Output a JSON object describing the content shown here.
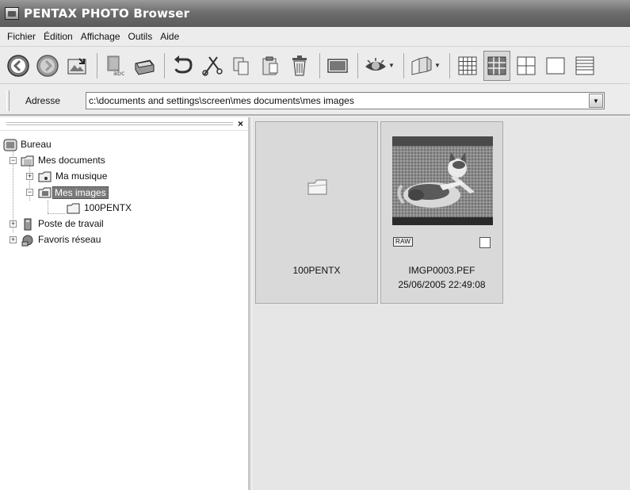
{
  "window": {
    "title": "PENTAX PHOTO Browser"
  },
  "menu": {
    "items": [
      "Fichier",
      "Édition",
      "Affichage",
      "Outils",
      "Aide"
    ]
  },
  "toolbar": {
    "buttons": [
      "back-icon",
      "forward-icon",
      "up-folder-icon",
      "rename-icon",
      "print-icon",
      "rotate-icon",
      "cut-icon",
      "copy-icon",
      "paste-icon",
      "delete-icon",
      "slideshow-icon",
      "view-icon",
      "compare-icon",
      "thumbs-small-icon",
      "thumbs-medium-icon",
      "thumbs-large-icon",
      "single-view-icon",
      "details-icon"
    ],
    "active": "thumbs-medium-icon"
  },
  "address": {
    "label": "Adresse",
    "value": "c:\\documents and settings\\screen\\mes documents\\mes images"
  },
  "tree": {
    "items": [
      {
        "label": "Bureau",
        "icon": "desktop-icon"
      },
      {
        "label": "Mes documents",
        "icon": "folder-icon"
      },
      {
        "label": "Ma musique",
        "icon": "music-folder-icon"
      },
      {
        "label": "Mes images",
        "icon": "pictures-folder-icon",
        "selected": true
      },
      {
        "label": "100PENTX",
        "icon": "folder-icon"
      },
      {
        "label": "Poste de travail",
        "icon": "computer-icon"
      },
      {
        "label": "Favoris réseau",
        "icon": "network-icon"
      }
    ]
  },
  "thumbnails": [
    {
      "name": "100PENTX",
      "type": "folder"
    },
    {
      "name": "IMGP0003.PEF",
      "date": "25/06/2005 22:49:08",
      "badge": "RAW",
      "type": "image"
    }
  ]
}
